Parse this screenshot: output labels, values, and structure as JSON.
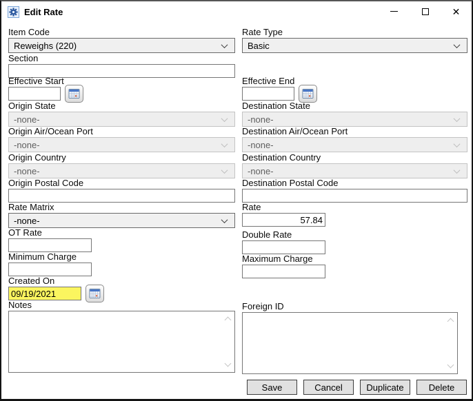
{
  "window": {
    "title": "Edit Rate"
  },
  "fields": {
    "item_code": {
      "label": "Item Code",
      "value": "Reweighs (220)"
    },
    "rate_type": {
      "label": "Rate Type",
      "value": "Basic"
    },
    "section": {
      "label": "Section",
      "value": ""
    },
    "effective_start": {
      "label": "Effective Start",
      "value": ""
    },
    "effective_end": {
      "label": "Effective End",
      "value": ""
    },
    "origin_state": {
      "label": "Origin State",
      "value": "-none-"
    },
    "destination_state": {
      "label": "Destination State",
      "value": "-none-"
    },
    "origin_port": {
      "label": "Origin Air/Ocean Port",
      "value": "-none-"
    },
    "destination_port": {
      "label": "Destination Air/Ocean Port",
      "value": "-none-"
    },
    "origin_country": {
      "label": "Origin Country",
      "value": "-none-"
    },
    "destination_country": {
      "label": "Destination Country",
      "value": "-none-"
    },
    "origin_postal": {
      "label": "Origin Postal Code",
      "value": ""
    },
    "destination_postal": {
      "label": "Destination Postal Code",
      "value": ""
    },
    "rate_matrix": {
      "label": "Rate Matrix",
      "value": "-none-"
    },
    "rate": {
      "label": "Rate",
      "value": "57.84"
    },
    "ot_rate": {
      "label": "OT Rate",
      "value": ""
    },
    "double_rate": {
      "label": "Double Rate",
      "value": ""
    },
    "minimum_charge": {
      "label": "Minimum Charge",
      "value": ""
    },
    "maximum_charge": {
      "label": "Maximum Charge",
      "value": ""
    },
    "created_on": {
      "label": "Created On",
      "value": "09/19/2021"
    },
    "notes": {
      "label": "Notes",
      "value": ""
    },
    "foreign_id": {
      "label": "Foreign ID",
      "value": ""
    }
  },
  "buttons": {
    "save": "Save",
    "cancel": "Cancel",
    "duplicate": "Duplicate",
    "delete": "Delete"
  },
  "colors": {
    "highlight_yellow": "#fbf55f",
    "calendar_header_blue": "#4472c4",
    "calendar_cell_orange": "#e8734a",
    "app_icon_blue": "#2d5aa0"
  }
}
